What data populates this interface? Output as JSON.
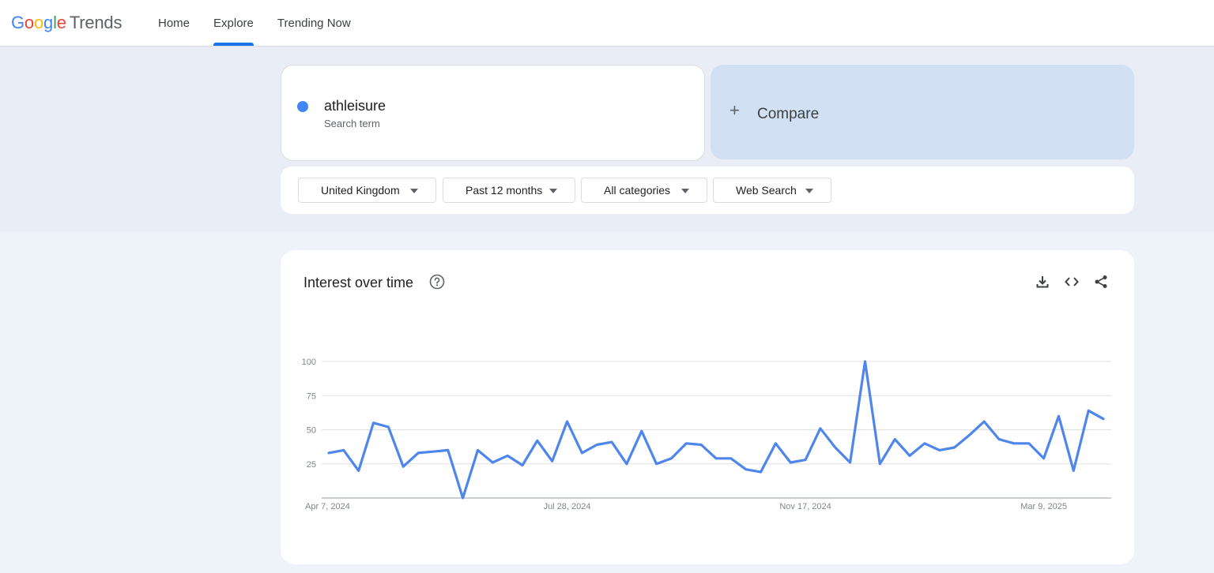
{
  "app": {
    "logo_letters": [
      "G",
      "o",
      "o",
      "g",
      "l",
      "e"
    ],
    "logo_suffix": "Trends",
    "nav": [
      {
        "label": "Home",
        "active": false
      },
      {
        "label": "Explore",
        "active": true
      },
      {
        "label": "Trending Now",
        "active": false
      }
    ]
  },
  "search": {
    "term": "athleisure",
    "term_subtitle": "Search term",
    "term_color": "#4285f4",
    "compare_label": "Compare"
  },
  "filters": {
    "region": "United Kingdom",
    "period": "Past 12 months",
    "category": "All categories",
    "property": "Web Search"
  },
  "panel": {
    "title": "Interest over time",
    "icons": [
      "help-icon",
      "download-icon",
      "embed-code-icon",
      "share-icon"
    ]
  },
  "chart_data": {
    "type": "line",
    "title": "Interest over time",
    "xlabel": "",
    "ylabel": "",
    "ylim": [
      0,
      100
    ],
    "yticks": [
      25,
      50,
      75,
      100
    ],
    "xtick_labels": [
      "Apr 7, 2024",
      "Jul 28, 2024",
      "Nov 17, 2024",
      "Mar 9, 2025"
    ],
    "xtick_indices": [
      0,
      16,
      32,
      48
    ],
    "grid": true,
    "line_color": "#4f86ec",
    "series": [
      {
        "name": "athleisure",
        "values": [
          33,
          35,
          20,
          55,
          52,
          23,
          33,
          34,
          35,
          0,
          35,
          26,
          31,
          24,
          42,
          27,
          56,
          33,
          39,
          41,
          25,
          49,
          25,
          29,
          40,
          39,
          29,
          29,
          21,
          19,
          40,
          26,
          28,
          51,
          37,
          26,
          100,
          25,
          43,
          31,
          40,
          35,
          37,
          46,
          56,
          43,
          40,
          40,
          29,
          60,
          20,
          64,
          58
        ]
      }
    ]
  }
}
